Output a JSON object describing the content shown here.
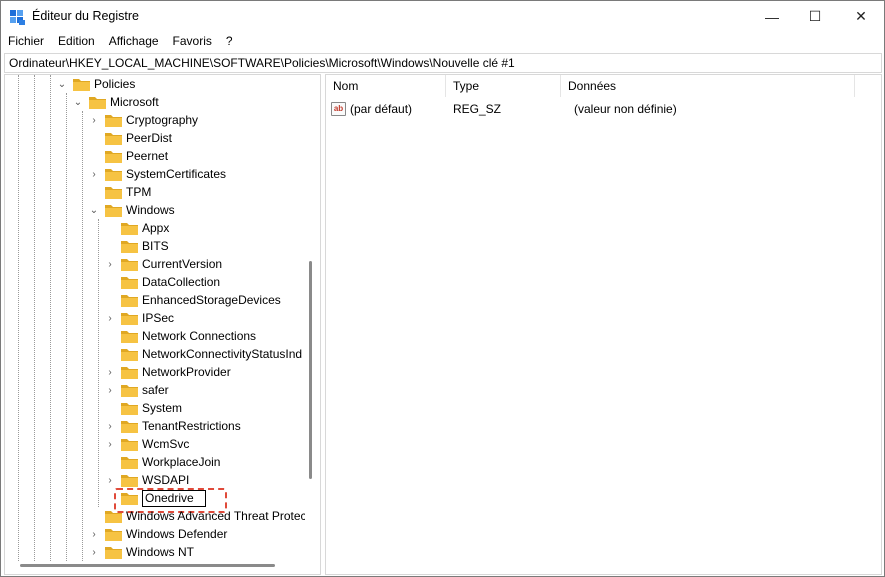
{
  "window": {
    "title": "Éditeur du Registre",
    "controls": {
      "minimize": "—",
      "maximize": "☐",
      "close": "✕"
    }
  },
  "menu": [
    "Fichier",
    "Edition",
    "Affichage",
    "Favoris",
    "?"
  ],
  "address": "Ordinateur\\HKEY_LOCAL_MACHINE\\SOFTWARE\\Policies\\Microsoft\\Windows\\Nouvelle clé #1",
  "tree": {
    "policies": "Policies",
    "microsoft": "Microsoft",
    "microsoft_children": [
      "Cryptography",
      "PeerDist",
      "Peernet",
      "SystemCertificates",
      "TPM",
      "Windows"
    ],
    "windows_children": [
      "Appx",
      "BITS",
      "CurrentVersion",
      "DataCollection",
      "EnhancedStorageDevices",
      "IPSec",
      "Network Connections",
      "NetworkConnectivityStatusInd",
      "NetworkProvider",
      "safer",
      "System",
      "TenantRestrictions",
      "WcmSvc",
      "WorkplaceJoin",
      "WSDAPI"
    ],
    "editing_key": "Onedrive",
    "after_windows": [
      "Windows Advanced Threat Protec",
      "Windows Defender",
      "Windows NT"
    ]
  },
  "list": {
    "columns": [
      "Nom",
      "Type",
      "Données"
    ],
    "rows": [
      {
        "name": "(par défaut)",
        "type": "REG_SZ",
        "data": "(valeur non définie)"
      }
    ]
  },
  "colors": {
    "folder": "#f6c343",
    "folder_dark": "#e0a823",
    "highlight": "#e04a3a",
    "app_icon": "#1e6fd9"
  }
}
